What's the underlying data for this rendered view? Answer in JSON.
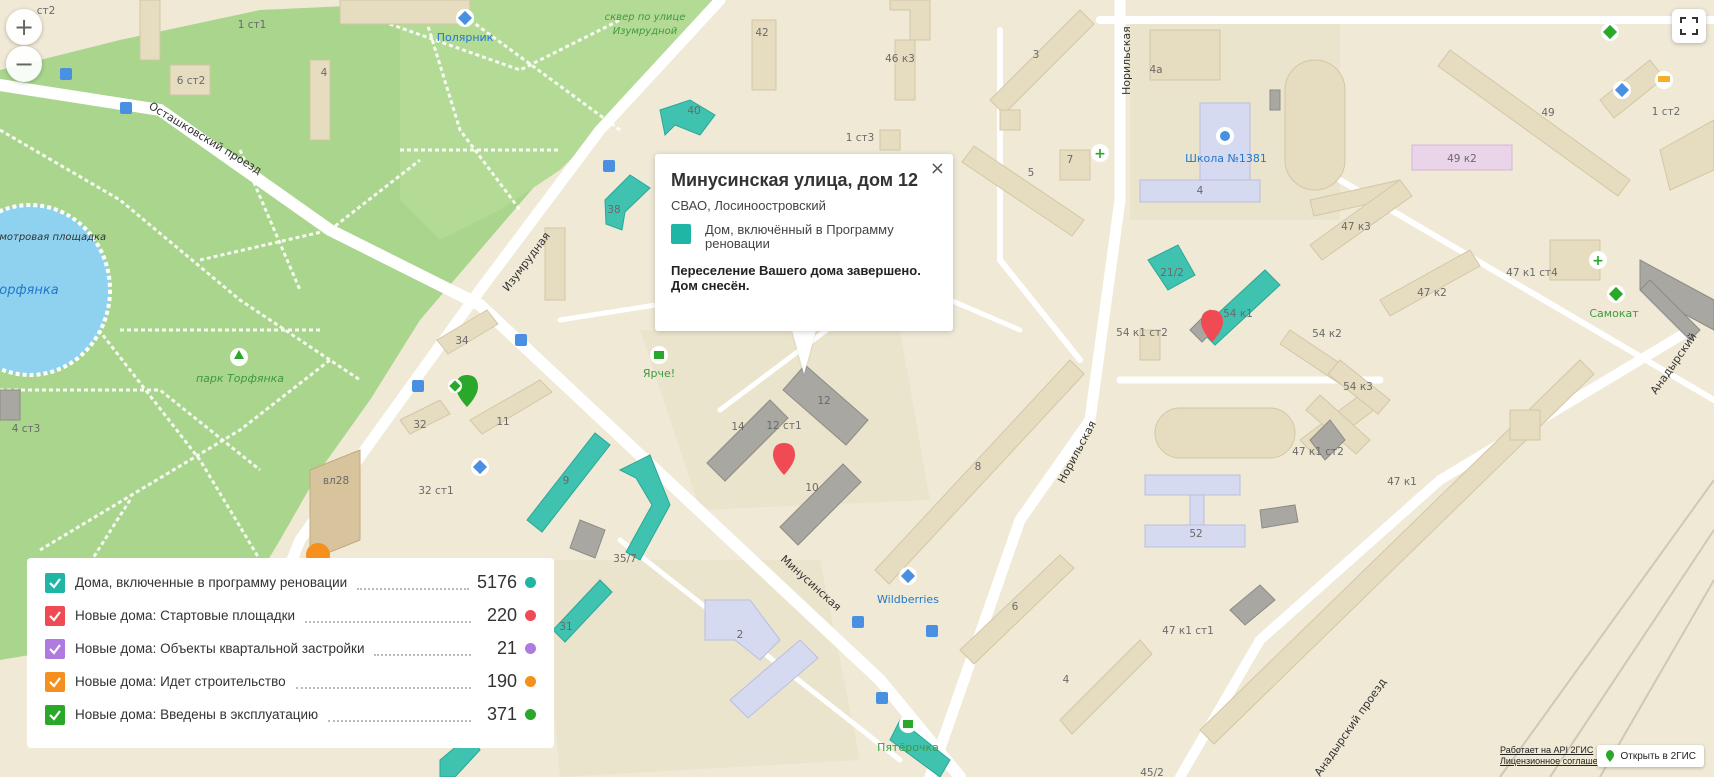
{
  "controls": {
    "zoom_in": "+",
    "zoom_out": "−"
  },
  "popup": {
    "close": "×",
    "title": "Минусинская улица, дом 12",
    "district": "СВАО, Лосиноостровский",
    "category": "Дом, включённый в Программу реновации",
    "status": "Переселение Вашего дома завершено. Дом снесён."
  },
  "legend": {
    "items": [
      {
        "label": "Дома, включенные в программу реновации",
        "count": "5176",
        "color": "#1fb6a6"
      },
      {
        "label": "Новые дома: Стартовые площадки",
        "count": "220",
        "color": "#f04a55"
      },
      {
        "label": "Новые дома: Объекты квартальной застройки",
        "count": "21",
        "color": "#b07be0"
      },
      {
        "label": "Новые дома: Идет строительство",
        "count": "190",
        "color": "#f5901e"
      },
      {
        "label": "Новые дома: Введены в эксплуатацию",
        "count": "371",
        "color": "#2aa82a"
      }
    ]
  },
  "map": {
    "streets": {
      "ostashkovsky": "Осташковский проезд",
      "izumrudnaya": "Изумрудная",
      "minusinskaya": "Минусинская",
      "norilskaya_top": "Норильская",
      "norilskaya_mid": "Норильская",
      "anadyrsky_right": "Анадырский",
      "anadyrsky_bottom": "Анадырский проезд"
    },
    "places": {
      "polyarnik": "Полярник",
      "skver": "сквер по улице Изумрудной",
      "school": "Школа №1381",
      "samokat": "Самокат",
      "yarche": "Ярче!",
      "wildberries": "Wildberries",
      "pyaterochka": "Пятёрочка",
      "park": "парк Торфянка",
      "lake": "Торфянка",
      "viewpoint": "смотровая площадка"
    },
    "buildings": [
      "1 ст1",
      "6 ст2",
      "4",
      "42",
      "46 к3",
      "3",
      "40",
      "1 ст3",
      "5",
      "7",
      "4а",
      "4",
      "49",
      "1 ст2",
      "49 к2",
      "47 к3",
      "47 к1 ст4",
      "47 к2",
      "54 к1",
      "54 к2",
      "54 к3",
      "54 к1 ст2",
      "21/2",
      "38",
      "34",
      "32",
      "11",
      "9",
      "14",
      "12 ст1",
      "12",
      "10",
      "8",
      "52",
      "47 к1 ст2",
      "47 к1",
      "6",
      "4",
      "47 к1 ст1",
      "2",
      "35/7",
      "31",
      "вл28",
      "32 ст1",
      "4 ст3",
      "45/2",
      "ст2"
    ]
  },
  "attribution": {
    "line1": "Работает на API 2ГИС",
    "line2": "Лицензионное соглашение"
  },
  "open_2gis": "Открыть в 2ГИС"
}
